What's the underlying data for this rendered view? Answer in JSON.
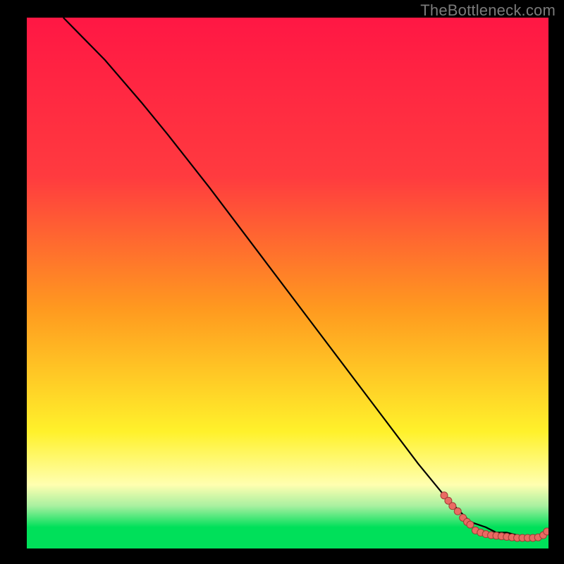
{
  "watermark": "TheBottleneck.com",
  "colors": {
    "black": "#000000",
    "curve": "#000000",
    "dot_fill": "#ea6a63",
    "dot_stroke": "#a03d36",
    "grad_top": "#ff1744",
    "grad_red": "#ff3b3f",
    "grad_orange": "#ff9a1f",
    "grad_yellow": "#fff12b",
    "grad_pale_yellow": "#ffffb0",
    "grad_pale_green": "#a8f0a0",
    "grad_green": "#00e05a"
  },
  "chart_data": {
    "type": "line",
    "title": "",
    "xlabel": "",
    "ylabel": "",
    "xlim": [
      0,
      100
    ],
    "ylim": [
      0,
      100
    ],
    "grid": false,
    "gradient_stops_pct": [
      0,
      30,
      55,
      78,
      88,
      92,
      96,
      100
    ],
    "gradient_colors": [
      "#ff1744",
      "#ff3b3f",
      "#ff9a1f",
      "#fff12b",
      "#ffffb0",
      "#a8f0a0",
      "#00e05a",
      "#00e05a"
    ],
    "series": [
      {
        "name": "curve",
        "x": [
          7,
          15,
          22,
          27,
          35,
          45,
          55,
          65,
          75,
          80,
          82,
          85,
          88,
          90,
          92,
          94,
          96,
          98,
          99,
          100
        ],
        "y": [
          100,
          92,
          84,
          78,
          68,
          55,
          42,
          29,
          16,
          10,
          8,
          5,
          4,
          3,
          3,
          2.5,
          2,
          2,
          2.2,
          3
        ]
      }
    ],
    "scatter": [
      {
        "x": 80.0,
        "y": 10.0
      },
      {
        "x": 80.8,
        "y": 9.0
      },
      {
        "x": 81.6,
        "y": 8.0
      },
      {
        "x": 82.6,
        "y": 7.0
      },
      {
        "x": 83.6,
        "y": 5.8
      },
      {
        "x": 84.4,
        "y": 5.0
      },
      {
        "x": 85.0,
        "y": 4.5
      },
      {
        "x": 86.0,
        "y": 3.4
      },
      {
        "x": 87.0,
        "y": 3.0
      },
      {
        "x": 88.0,
        "y": 2.7
      },
      {
        "x": 89.0,
        "y": 2.5
      },
      {
        "x": 90.0,
        "y": 2.4
      },
      {
        "x": 91.0,
        "y": 2.3
      },
      {
        "x": 92.0,
        "y": 2.2
      },
      {
        "x": 93.0,
        "y": 2.1
      },
      {
        "x": 94.0,
        "y": 2.0
      },
      {
        "x": 95.0,
        "y": 2.0
      },
      {
        "x": 96.0,
        "y": 2.0
      },
      {
        "x": 97.0,
        "y": 2.0
      },
      {
        "x": 98.0,
        "y": 2.1
      },
      {
        "x": 99.0,
        "y": 2.5
      },
      {
        "x": 99.7,
        "y": 3.2
      }
    ]
  }
}
